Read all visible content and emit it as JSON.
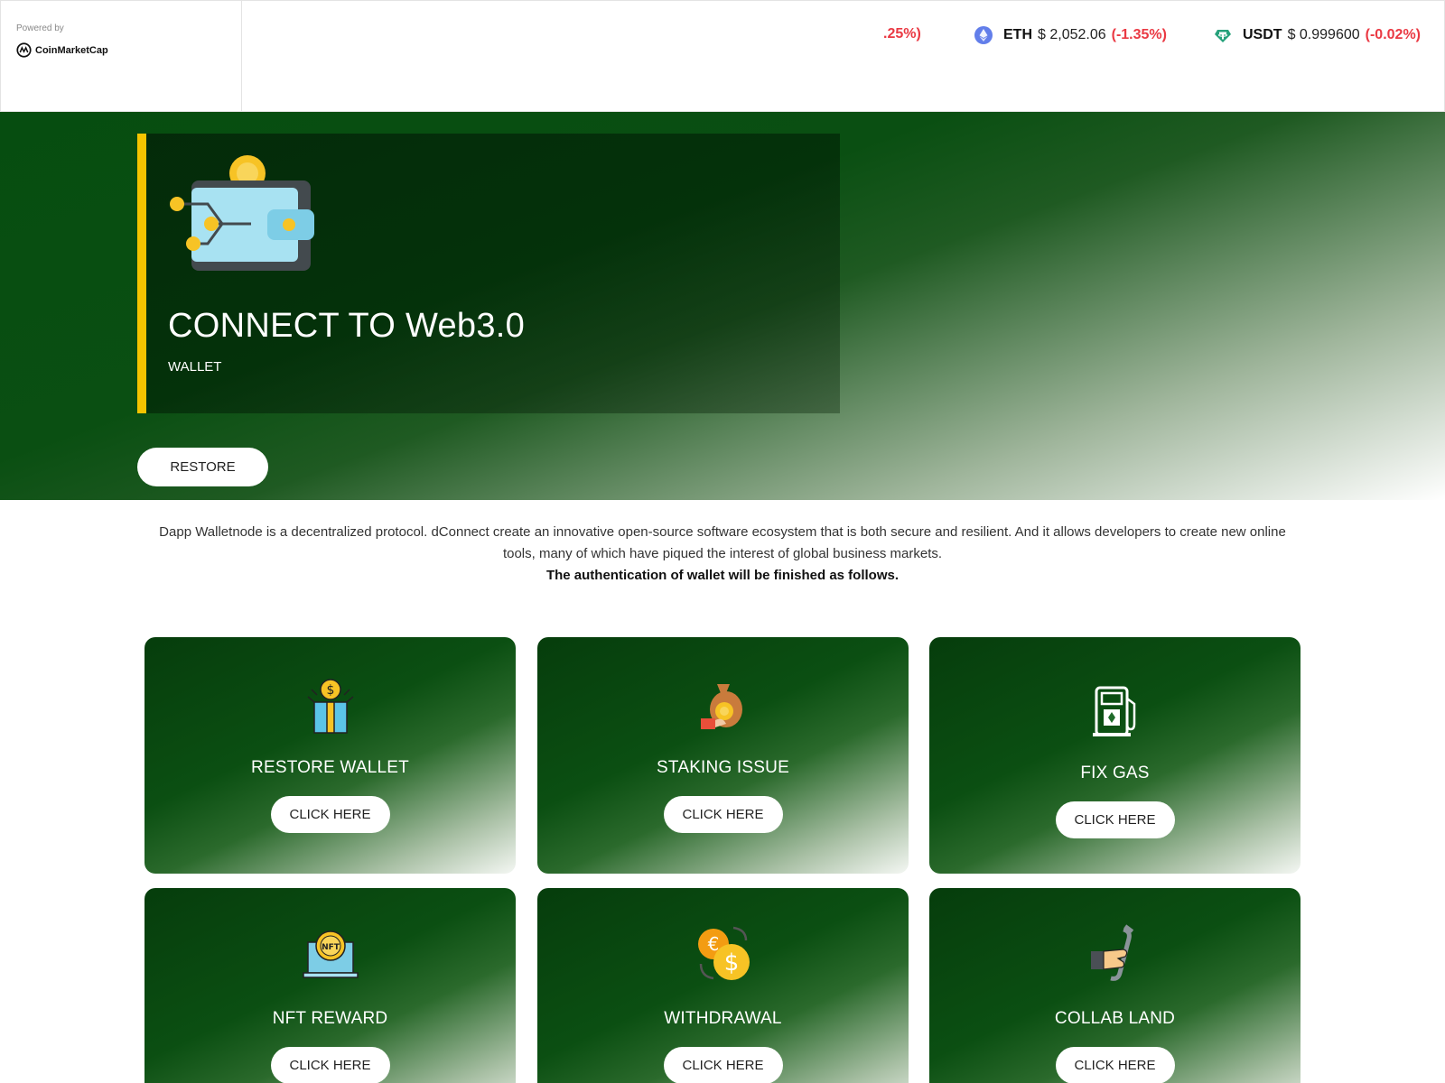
{
  "ticker": {
    "powered_by": "Powered by",
    "brand": "CoinMarketCap",
    "coins": [
      {
        "symbol": "",
        "price": "",
        "change": ".25%)",
        "icon": "none"
      },
      {
        "symbol": "ETH",
        "price": "$ 2,052.06",
        "change": "(-1.35%)",
        "icon": "ethereum-icon"
      },
      {
        "symbol": "USDT",
        "price": "$ 0.999600",
        "change": "(-0.02%)",
        "icon": "tether-icon"
      }
    ],
    "negative_color": "#ea3943"
  },
  "hero": {
    "title": "CONNECT TO Web3.0",
    "subtitle": "WALLET",
    "restore_label": "RESTORE",
    "accent_color": "#f5c400"
  },
  "intro": {
    "text": "Dapp Walletnode is a decentralized protocol. dConnect create an innovative open-source software ecosystem that is both secure and resilient. And it allows developers to create new online tools, many of which have piqued the interest of global business markets.",
    "bold_text": "The authentication of wallet will be finished as follows."
  },
  "cards": [
    {
      "title": "RESTORE WALLET",
      "button": "CLICK HERE",
      "icon": "gift-box-dollar-icon"
    },
    {
      "title": "STAKING ISSUE",
      "button": "CLICK HERE",
      "icon": "money-bag-hand-icon"
    },
    {
      "title": "FIX GAS",
      "button": "CLICK HERE",
      "icon": "gas-pump-icon"
    },
    {
      "title": "NFT REWARD",
      "button": "CLICK HERE",
      "icon": "nft-laptop-icon"
    },
    {
      "title": "WITHDRAWAL",
      "button": "CLICK HERE",
      "icon": "currency-exchange-icon"
    },
    {
      "title": "COLLAB LAND",
      "button": "CLICK HERE",
      "icon": "wrench-hand-icon"
    }
  ]
}
